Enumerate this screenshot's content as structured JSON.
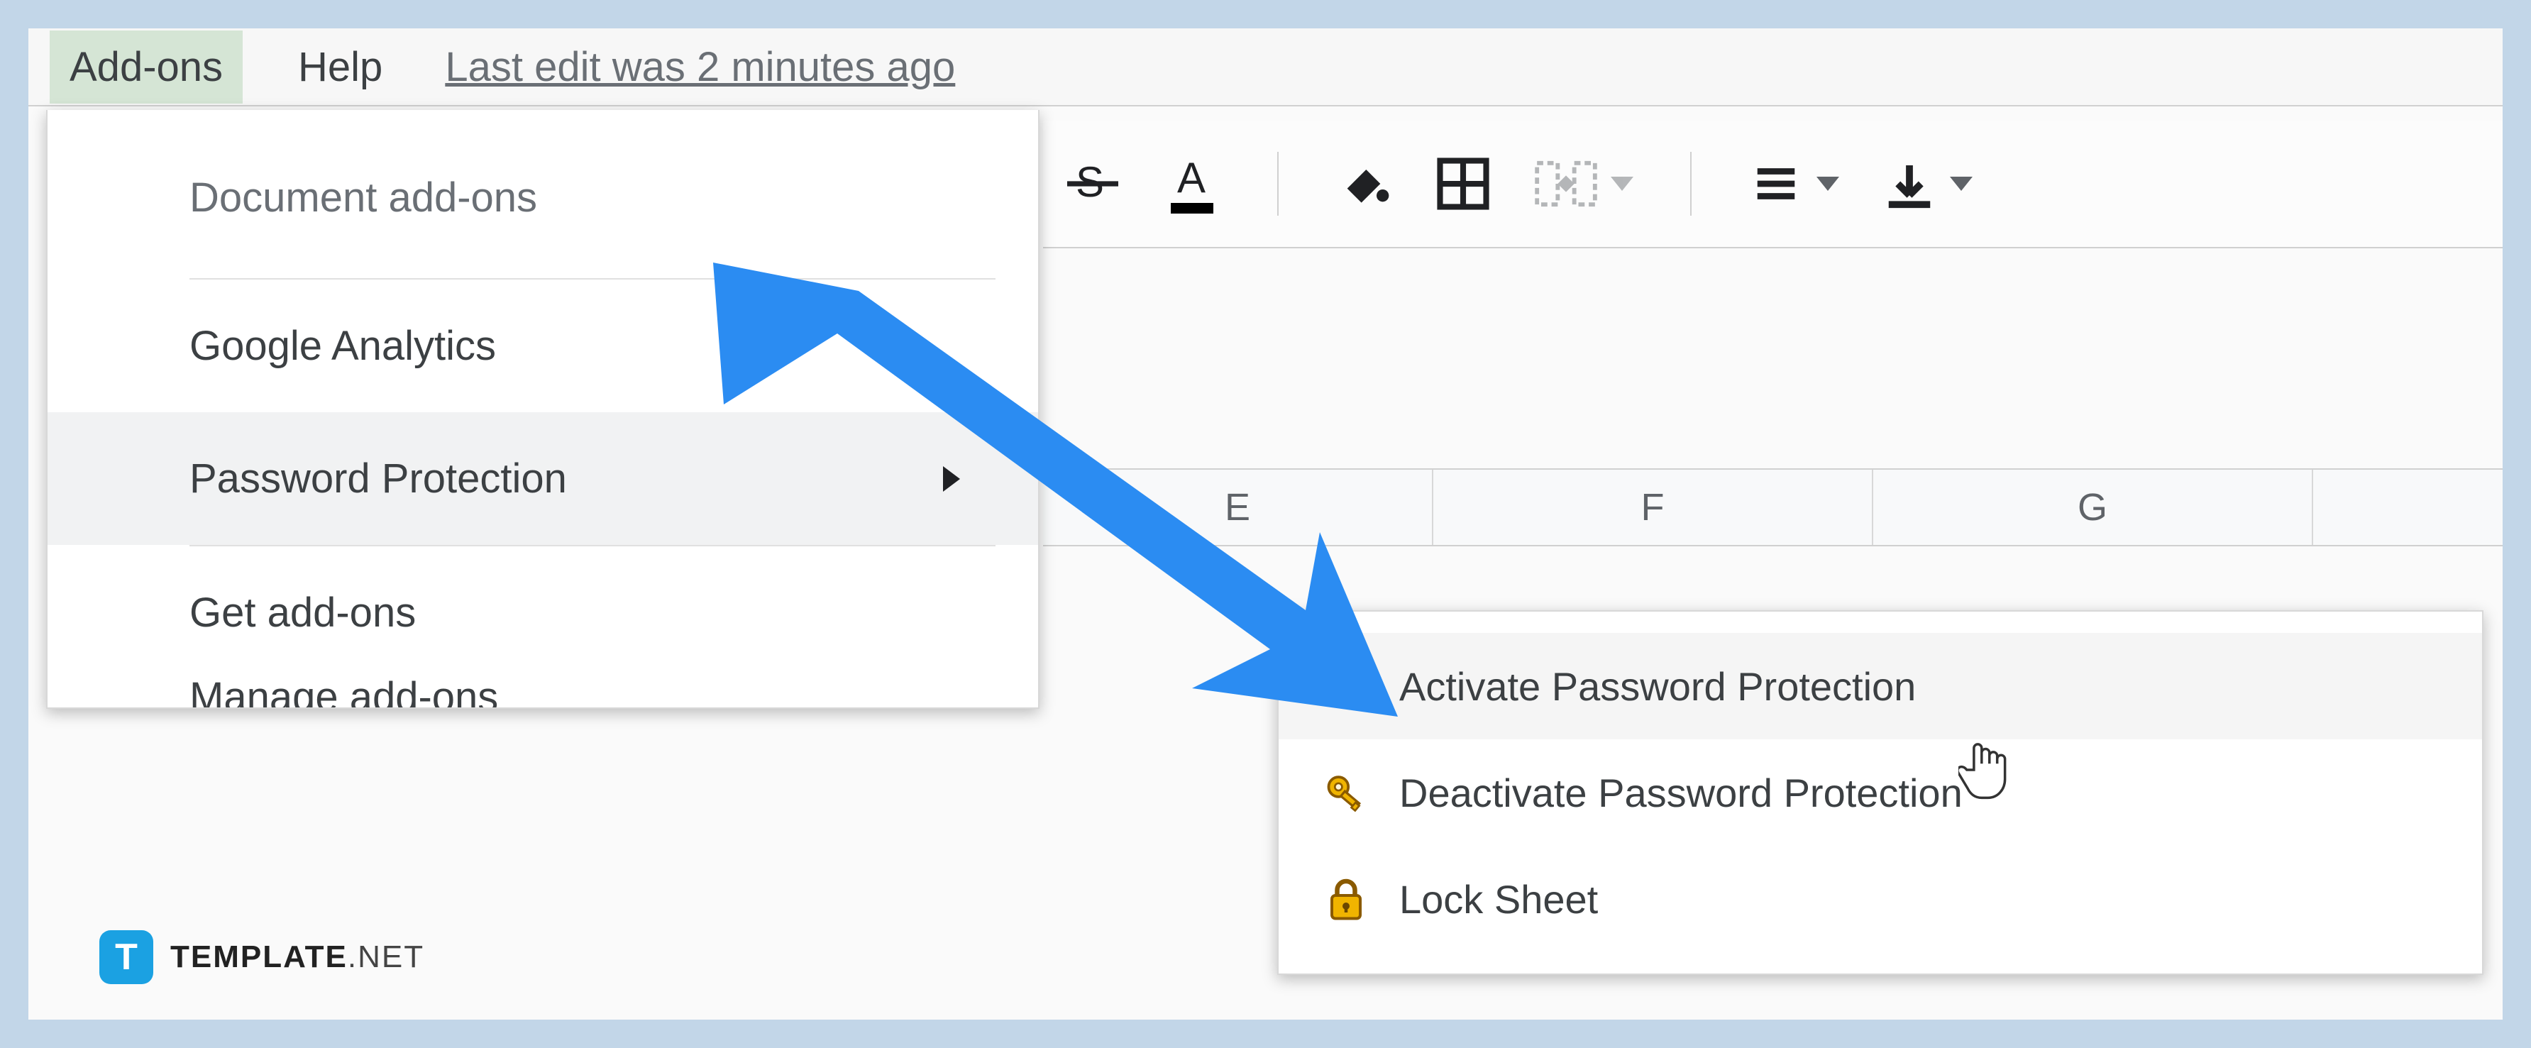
{
  "menubar": {
    "addons_label": "Add-ons",
    "help_label": "Help",
    "edit_status": "Last edit was 2 minutes ago"
  },
  "dropdown": {
    "section_header": "Document add-ons",
    "items": [
      {
        "label": "Google Analytics"
      },
      {
        "label": "Password Protection"
      },
      {
        "label": "Get add-ons"
      },
      {
        "label": "Manage add-ons"
      }
    ]
  },
  "submenu": {
    "items": [
      {
        "label": "Activate Password Protection",
        "icon": "key"
      },
      {
        "label": "Deactivate Password Protection",
        "icon": "key"
      },
      {
        "label": "Lock Sheet",
        "icon": "lock"
      }
    ]
  },
  "columns": [
    "E",
    "F",
    "G"
  ],
  "watermark": {
    "badge": "T",
    "bold": "TEMPLATE",
    "light": ".NET"
  }
}
